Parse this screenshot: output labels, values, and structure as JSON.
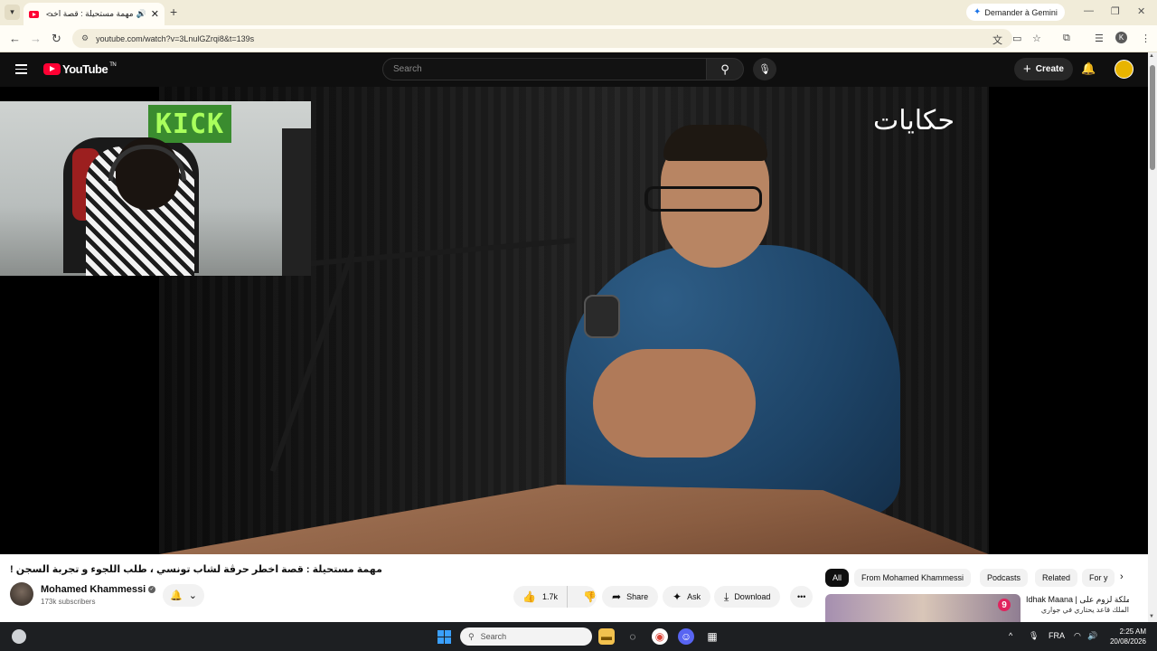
{
  "browser": {
    "tab_title": "مهمة مستحيلة : قصة اخطر",
    "new_tab": "+",
    "gemini_label": "Demander à Gemini",
    "url": "youtube.com/watch?v=3LnulGZrqi8&t=139s",
    "profile_initial": "K"
  },
  "youtube": {
    "logo_text": "YouTube",
    "logo_region": "TN",
    "search_placeholder": "Search",
    "create_label": "Create"
  },
  "video": {
    "watermark": "حكايات",
    "kick_sign": "KICK",
    "title": "مهمة مستحيلة : قصة اخطر حرڨة لشاب تونسي ، طلب اللجوء و تجربة السجن !",
    "channel_name": "Mohamed Khammessi",
    "subscribers": "173k subscribers",
    "like_count": "1.7k",
    "share_label": "Share",
    "ask_label": "Ask",
    "download_label": "Download"
  },
  "recommendations": {
    "chips": [
      "All",
      "From Mohamed Khammessi",
      "Podcasts",
      "Related",
      "For y"
    ],
    "first": {
      "title": "Idhak Maana | الملكة لزوم على",
      "subtitle": "الملك قاعد يحتاري في جواري",
      "badge": "9"
    }
  },
  "taskbar": {
    "search_placeholder": "Search",
    "language": "FRA",
    "time": "2:25 AM",
    "date": "20/08/2026"
  },
  "colors": {
    "youtube_red": "#ff0033",
    "masthead_bg": "#0f0f0f",
    "chrome_frame": "#f1ecd9"
  }
}
